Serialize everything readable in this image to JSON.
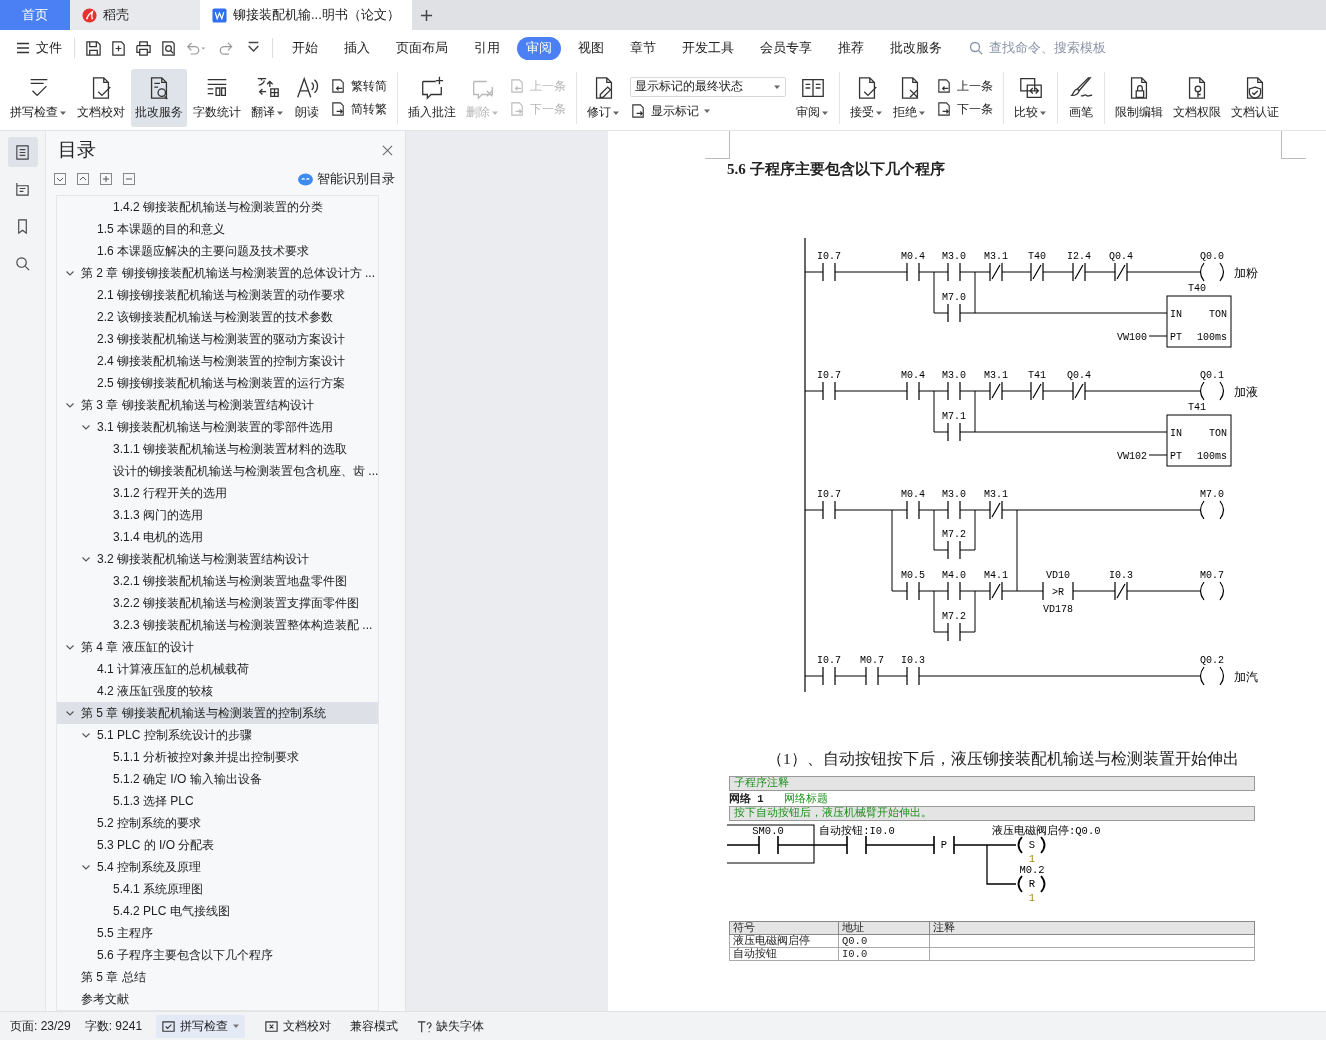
{
  "tabs": [
    {
      "kind": "home",
      "label": "首页",
      "selected": false
    },
    {
      "kind": "app",
      "label": "稻壳",
      "selected": false
    },
    {
      "kind": "doc",
      "label": "铆接装配机输...明书（论文）",
      "selected": true
    }
  ],
  "menu": {
    "file": "文件",
    "tabs": [
      {
        "label": "开始",
        "selected": false
      },
      {
        "label": "插入",
        "selected": false
      },
      {
        "label": "页面布局",
        "selected": false
      },
      {
        "label": "引用",
        "selected": false
      },
      {
        "label": "审阅",
        "selected": true
      },
      {
        "label": "视图",
        "selected": false
      },
      {
        "label": "章节",
        "selected": false
      },
      {
        "label": "开发工具",
        "selected": false
      },
      {
        "label": "会员专享",
        "selected": false
      },
      {
        "label": "推荐",
        "selected": false
      },
      {
        "label": "批改服务",
        "selected": false
      }
    ],
    "search": {
      "placeholder": "查找命令、搜索模板"
    }
  },
  "ribbon": {
    "groups": [
      {
        "items": [
          {
            "kind": "large",
            "label": "拼写检查",
            "caret": true,
            "disabled": false,
            "pressed": false
          },
          {
            "kind": "large",
            "label": "文档校对",
            "caret": false,
            "disabled": false,
            "pressed": false
          },
          {
            "kind": "large",
            "label": "批改服务",
            "caret": false,
            "disabled": false,
            "pressed": true
          },
          {
            "kind": "large",
            "label": "字数统计",
            "caret": false,
            "disabled": false,
            "pressed": false
          },
          {
            "kind": "large",
            "label": "翻译",
            "caret": true,
            "disabled": false,
            "pressed": false
          },
          {
            "kind": "large",
            "label": "朗读",
            "caret": false,
            "disabled": false,
            "pressed": false
          },
          {
            "kind": "stack",
            "items": [
              {
                "kind": "small",
                "label": "繁转简",
                "caret": false,
                "disabled": false
              },
              {
                "kind": "small",
                "label": "简转繁",
                "caret": false,
                "disabled": false
              }
            ]
          }
        ]
      },
      {
        "items": [
          {
            "kind": "large",
            "label": "插入批注",
            "caret": false,
            "disabled": false,
            "pressed": false
          },
          {
            "kind": "large",
            "label": "删除",
            "caret": true,
            "disabled": true,
            "pressed": false
          },
          {
            "kind": "stack",
            "items": [
              {
                "kind": "small",
                "label": "上一条",
                "caret": false,
                "disabled": true
              },
              {
                "kind": "small",
                "label": "下一条",
                "caret": false,
                "disabled": true
              }
            ]
          }
        ]
      },
      {
        "items": [
          {
            "kind": "large",
            "label": "修订",
            "caret": true,
            "disabled": false,
            "pressed": false
          },
          {
            "kind": "stack",
            "items": [
              {
                "kind": "select",
                "value": "显示标记的最终状态"
              },
              {
                "kind": "small",
                "label": "显示标记",
                "caret": true,
                "disabled": false
              }
            ]
          },
          {
            "kind": "large",
            "label": "审阅",
            "caret": true,
            "disabled": false,
            "pressed": false
          }
        ]
      },
      {
        "items": [
          {
            "kind": "large",
            "label": "接受",
            "caret": true,
            "disabled": false,
            "pressed": false
          },
          {
            "kind": "large",
            "label": "拒绝",
            "caret": true,
            "disabled": false,
            "pressed": false
          },
          {
            "kind": "stack",
            "items": [
              {
                "kind": "small",
                "label": "上一条",
                "caret": false,
                "disabled": false
              },
              {
                "kind": "small",
                "label": "下一条",
                "caret": false,
                "disabled": false
              }
            ]
          }
        ]
      },
      {
        "items": [
          {
            "kind": "large",
            "label": "比较",
            "caret": true,
            "disabled": false,
            "pressed": false
          }
        ]
      },
      {
        "items": [
          {
            "kind": "large",
            "label": "画笔",
            "caret": false,
            "disabled": false,
            "pressed": false
          }
        ]
      },
      {
        "items": [
          {
            "kind": "large",
            "label": "限制编辑",
            "caret": false,
            "disabled": false,
            "pressed": false
          },
          {
            "kind": "large",
            "label": "文档权限",
            "caret": false,
            "disabled": false,
            "pressed": false
          },
          {
            "kind": "large",
            "label": "文档认证",
            "caret": false,
            "disabled": false,
            "pressed": false
          }
        ]
      }
    ]
  },
  "rail": [
    {
      "selected": true
    },
    {
      "selected": false
    },
    {
      "selected": false
    },
    {
      "selected": false
    }
  ],
  "toc": {
    "title": "目录",
    "smart": "智能识别目录",
    "items": [
      {
        "children": [
          {
            "children": [
              {
                "label": "1.4.2 铆接装配机输送与检测装置的分类",
                "selected": false
              }
            ]
          },
          {
            "label": "1.5 本课题的目的和意义",
            "selected": false
          },
          {
            "label": "1.6  本课题应解决的主要问题及技术要求",
            "selected": false
          }
        ]
      },
      {
        "label": "第 2 章  铆接铆接装配机输送与检测装置的总体设计方 ...",
        "selected": false,
        "expanded": true,
        "children": [
          {
            "label": "2.1  铆接铆接装配机输送与检测装置的动作要求",
            "selected": false
          },
          {
            "label": "2.2 该铆接装配机输送与检测装置的技术参数",
            "selected": false
          },
          {
            "label": "2.3 铆接装配机输送与检测装置的驱动方案设计",
            "selected": false
          },
          {
            "label": "2.4 铆接装配机输送与检测装置的控制方案设计",
            "selected": false
          },
          {
            "label": "2.5 铆接铆接装配机输送与检测装置的运行方案",
            "selected": false
          }
        ]
      },
      {
        "label": "第 3 章  铆接装配机输送与检测装置结构设计",
        "selected": false,
        "expanded": true,
        "children": [
          {
            "label": "3.1 铆接装配机输送与检测装置的零部件选用",
            "selected": false,
            "expanded": true,
            "children": [
              {
                "label": "3.1.1 铆接装配机输送与检测装置材料的选取",
                "selected": false
              },
              {
                "label": "设计的铆接装配机输送与检测装置包含机座、齿 ...",
                "selected": false
              },
              {
                "label": "3.1.2 行程开关的选用",
                "selected": false
              },
              {
                "label": "3.1.3 阀门的选用",
                "selected": false
              },
              {
                "label": "3.1.4 电机的选用",
                "selected": false
              }
            ]
          },
          {
            "label": "3.2 铆接装配机输送与检测装置结构设计",
            "selected": false,
            "expanded": true,
            "children": [
              {
                "label": "3.2.1 铆接装配机输送与检测装置地盘零件图",
                "selected": false
              },
              {
                "label": "3.2.2 铆接装配机输送与检测装置支撑面零件图",
                "selected": false
              },
              {
                "label": "3.2.3 铆接装配机输送与检测装置整体构造装配 ...",
                "selected": false
              }
            ]
          }
        ]
      },
      {
        "label": "第 4 章  液压缸的设计",
        "selected": false,
        "expanded": true,
        "children": [
          {
            "label": "4.1 计算液压缸的总机械载荷",
            "selected": false
          },
          {
            "label": "4.2 液压缸强度的较核",
            "selected": false
          }
        ]
      },
      {
        "label": "第 5 章  铆接装配机输送与检测装置的控制系统",
        "selected": true,
        "expanded": true,
        "children": [
          {
            "label": "5.1 PLC 控制系统设计的步骤",
            "selected": false,
            "expanded": true,
            "children": [
              {
                "label": "5.1.1 分析被控对象并提出控制要求",
                "selected": false
              },
              {
                "label": "5.1.2 确定 I/O 输入输出设备",
                "selected": false
              },
              {
                "label": "5.1.3 选择 PLC",
                "selected": false
              }
            ]
          },
          {
            "label": "5.2 控制系统的要求",
            "selected": false
          },
          {
            "label": "5.3 PLC 的 I/O 分配表",
            "selected": false
          },
          {
            "label": "5.4  控制系统及原理",
            "selected": false,
            "expanded": true,
            "children": [
              {
                "label": "5.4.1 系统原理图",
                "selected": false
              },
              {
                "label": "5.4.2 PLC 电气接线图",
                "selected": false
              }
            ]
          },
          {
            "label": "5.5 主程序",
            "selected": false
          },
          {
            "label": "5.6 子程序主要包含以下几个程序",
            "selected": false
          }
        ]
      },
      {
        "label": "第 5 章  总结",
        "selected": false
      },
      {
        "label": "参考文献",
        "selected": false
      }
    ]
  },
  "document": {
    "heading": "5.6 子程序主要包含以下几个程序",
    "ladder": {
      "rungs": [
        {
          "elements": [
            {
              "kind": "no",
              "label": "I0.7"
            },
            {
              "kind": "no",
              "label": "M0.4"
            },
            {
              "kind": "no",
              "label": "M3.0"
            },
            {
              "kind": "nc",
              "label": "M3.1"
            },
            {
              "kind": "nc",
              "label": "T40"
            },
            {
              "kind": "nc",
              "label": "I2.4"
            },
            {
              "kind": "nc",
              "label": "Q0.4"
            },
            {
              "kind": "coil",
              "label": "Q0.0",
              "note": "加粉"
            },
            {
              "kind": "no",
              "label": "M7.0"
            },
            {
              "kind": "timer",
              "name": "T40",
              "input": "IN",
              "type": "TON",
              "preset_pin": "PT",
              "base": "100ms",
              "preset": "VW100"
            }
          ]
        },
        {
          "elements": [
            {
              "kind": "no",
              "label": "I0.7"
            },
            {
              "kind": "no",
              "label": "M0.4"
            },
            {
              "kind": "no",
              "label": "M3.0"
            },
            {
              "kind": "nc",
              "label": "M3.1"
            },
            {
              "kind": "nc",
              "label": "T41"
            },
            {
              "kind": "nc",
              "label": "Q0.4"
            },
            {
              "kind": "coil",
              "label": "Q0.1",
              "note": "加液"
            },
            {
              "kind": "no",
              "label": "M7.1"
            },
            {
              "kind": "timer",
              "name": "T41",
              "input": "IN",
              "type": "TON",
              "preset_pin": "PT",
              "base": "100ms",
              "preset": "VW102"
            }
          ]
        },
        {
          "elements": [
            {
              "kind": "no",
              "label": "I0.7"
            },
            {
              "kind": "no",
              "label": "M0.4"
            },
            {
              "kind": "no",
              "label": "M3.0"
            },
            {
              "kind": "nc",
              "label": "M3.1"
            },
            {
              "kind": "coil",
              "label": "M7.0"
            },
            {
              "kind": "no",
              "label": "M7.2"
            },
            {
              "kind": "no",
              "label": "M0.5"
            },
            {
              "kind": "no",
              "label": "M4.0"
            },
            {
              "kind": "nc",
              "label": "M4.1"
            },
            {
              "kind": "no",
              "label": "M7.2"
            },
            {
              "kind": "compare",
              "operand1": "VD10",
              "operator": ">R",
              "operand2": "VD178"
            },
            {
              "kind": "nc",
              "label": "I0.3"
            },
            {
              "kind": "coil",
              "label": "M0.7"
            }
          ]
        },
        {
          "elements": [
            {
              "kind": "no",
              "label": "I0.7"
            },
            {
              "kind": "no",
              "label": "M0.7"
            },
            {
              "kind": "no",
              "label": "I0.3"
            },
            {
              "kind": "coil",
              "label": "Q0.2",
              "note": "加汽"
            }
          ]
        }
      ]
    },
    "paragraph": "（1）、自动按钮按下后，液压铆接装配机输送与检测装置开始伸出",
    "network": {
      "comment": "子程序注释",
      "title": "网络 1",
      "subtitle": "网络标题",
      "description": "按下自动按钮后，液压机械臂开始伸出。",
      "contacts": [
        "SM0.0",
        "自动按钮:I0.0"
      ],
      "edge": "P",
      "coils": [
        {
          "label": "液压电磁阀启停:Q0.0",
          "op": "S",
          "count": "1"
        },
        {
          "label": "M0.2",
          "op": "R",
          "count": "1"
        }
      ],
      "table": {
        "columns": [
          "符号",
          "地址",
          "注释"
        ],
        "rows": [
          [
            "液压电磁阀启停",
            "Q0.0"
          ],
          [
            "自动按钮",
            "I0.0"
          ]
        ]
      }
    }
  },
  "status": [
    {
      "kind": "text",
      "label": "页面: 23/29"
    },
    {
      "kind": "text",
      "label": "字数: 9241"
    },
    {
      "kind": "spell",
      "label": "拼写检查",
      "on": true
    },
    {
      "kind": "proof",
      "label": "文档校对",
      "on": false
    },
    {
      "kind": "text",
      "label": "兼容模式"
    },
    {
      "kind": "font",
      "label": "缺失字体"
    }
  ]
}
